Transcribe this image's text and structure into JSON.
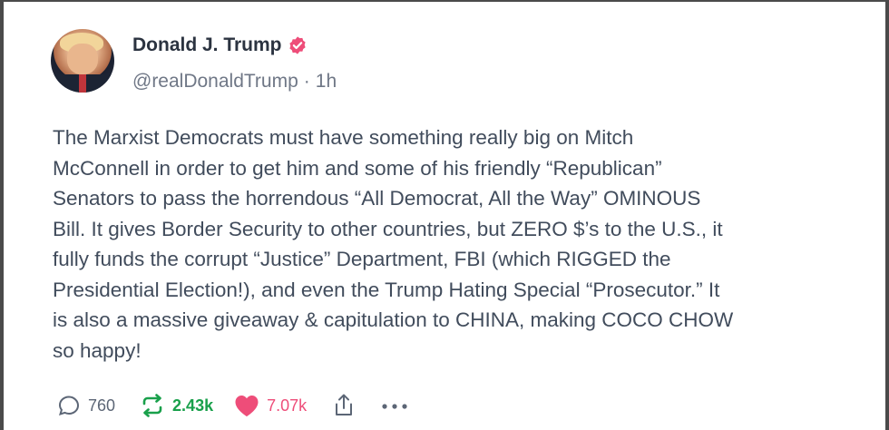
{
  "post": {
    "author": {
      "display_name": "Donald J. Trump",
      "handle": "@realDonaldTrump",
      "separator": "·",
      "time": "1h"
    },
    "body": "The Marxist Democrats must have something really big on Mitch\nMcConnell in order to get him and some of his friendly “Republican”\nSenators to pass the horrendous “All Democrat, All the Way” OMINOUS\nBill. It gives Border Security to other countries, but ZERO $’s to the U.S., it\nfully funds the corrupt “Justice” Department, FBI (which RIGGED the\nPresidential Election!), and even the Trump Hating Special “Prosecutor.” It\nis also a massive giveaway & capitulation to CHINA, making COCO CHOW\nso happy!",
    "stats": {
      "replies": "760",
      "reposts": "2.43k",
      "likes": "7.07k"
    }
  },
  "icons": {
    "verified": "verified-badge-icon",
    "reply": "comment-icon",
    "repost": "repost-icon",
    "like": "heart-icon",
    "share": "share-icon",
    "more": "more-dots-icon"
  },
  "colors": {
    "verified": "#ee4d79",
    "repost": "#19a04b",
    "like": "#ee4d79",
    "text": "#414c5c",
    "muted": "#6f7786"
  }
}
